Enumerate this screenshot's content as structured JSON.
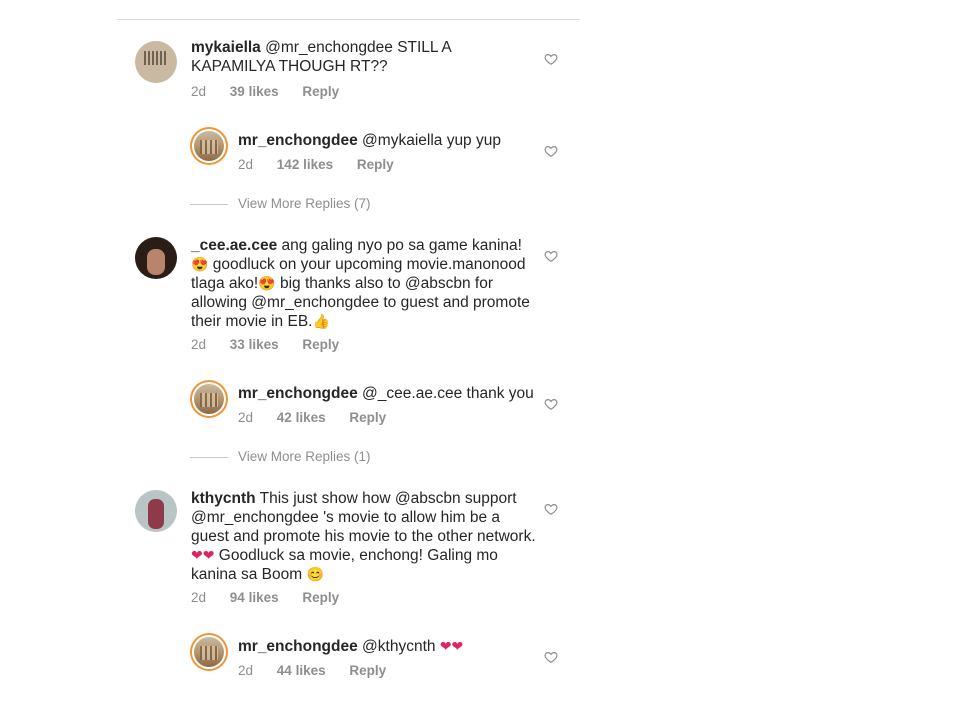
{
  "comments": [
    {
      "username": "mykaiella",
      "text": "@mr_enchongdee STILL A KAPAMILYA THOUGH RT??",
      "time": "2d",
      "likes": "39 likes",
      "reply": "Reply",
      "replies": [
        {
          "username": "mr_enchongdee",
          "text": "@mykaiella yup yup",
          "time": "2d",
          "likes": "142 likes",
          "reply": "Reply"
        }
      ],
      "view_more": "View More Replies (7)"
    },
    {
      "username": "_cee.ae.cee",
      "text_parts": [
        "ang galing nyo po sa game kanina!",
        "😍",
        " goodluck on your upcoming movie.manonood tlaga ako!",
        "😍",
        " big thanks also to @abscbn for allowing @mr_enchongdee to guest and promote their movie in EB.",
        "👍"
      ],
      "time": "2d",
      "likes": "33 likes",
      "reply": "Reply",
      "replies": [
        {
          "username": "mr_enchongdee",
          "text": "@_cee.ae.cee thank you",
          "time": "2d",
          "likes": "42 likes",
          "reply": "Reply"
        }
      ],
      "view_more": "View More Replies (1)"
    },
    {
      "username": "kthycnth",
      "text_parts": [
        "This just show how @abscbn support @mr_enchongdee 's movie to allow him be a guest and promote his movie to the other network. ",
        "❤❤",
        " Goodluck sa movie, enchong! Galing mo kanina sa Boom ",
        "😊"
      ],
      "time": "2d",
      "likes": "94 likes",
      "reply": "Reply",
      "replies": [
        {
          "username": "mr_enchongdee",
          "text": "@kthycnth",
          "emoji": "❤❤",
          "time": "2d",
          "likes": "44 likes",
          "reply": "Reply"
        }
      ]
    }
  ],
  "icons": {
    "like": "heart-outline-icon",
    "avatar": "profile-picture"
  },
  "colors": {
    "text": "#262626",
    "meta": "#8e8e8e",
    "divider": "#dbdbdb",
    "heart_emoji": "#e0245e"
  }
}
